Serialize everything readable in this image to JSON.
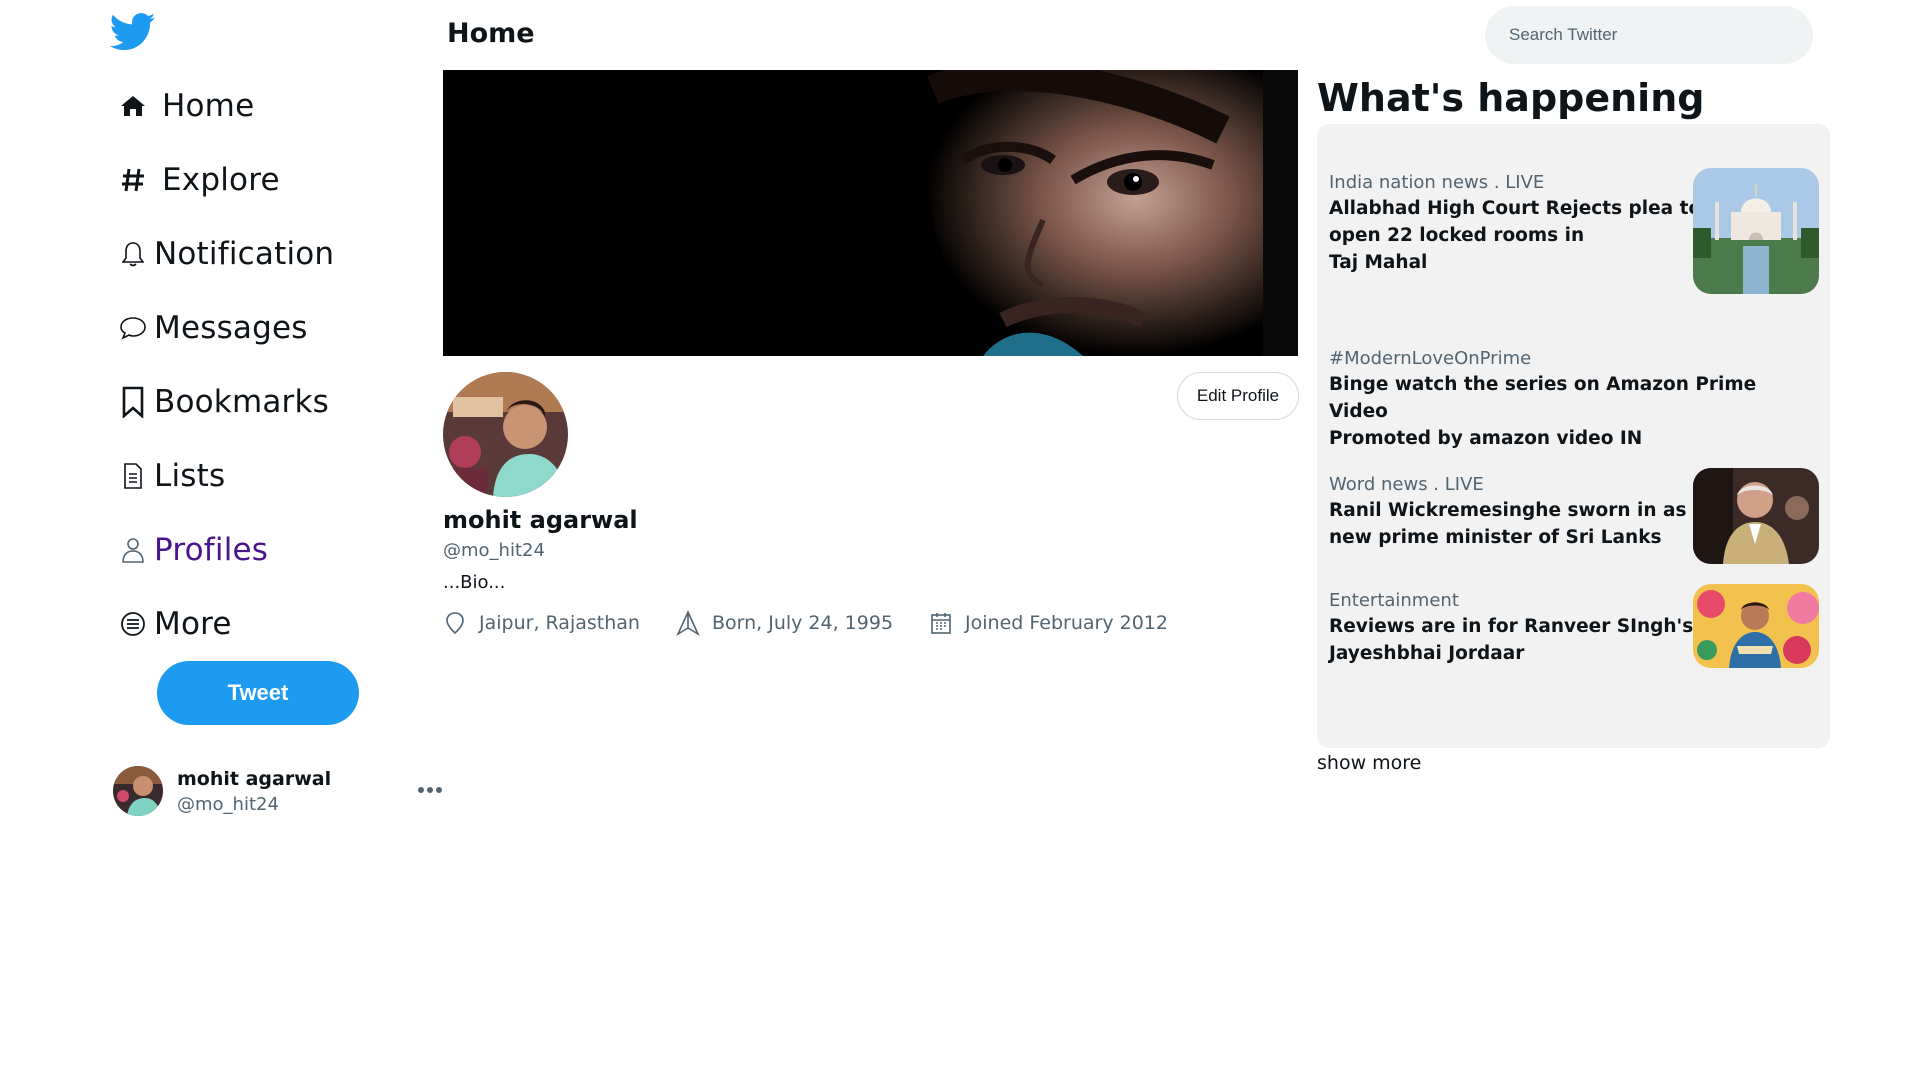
{
  "sidebar": {
    "logo": "twitter-bird-icon",
    "nav": [
      {
        "label": "Home",
        "icon": "home-icon"
      },
      {
        "label": "Explore",
        "icon": "hashtag-icon"
      },
      {
        "label": "Notification",
        "icon": "bell-icon"
      },
      {
        "label": "Messages",
        "icon": "chat-bubble-icon"
      },
      {
        "label": "Bookmarks",
        "icon": "bookmark-icon"
      },
      {
        "label": "Lists",
        "icon": "document-icon"
      },
      {
        "label": "Profiles",
        "icon": "user-icon"
      },
      {
        "label": "More",
        "icon": "more-circle-icon"
      }
    ],
    "active_item": "Profiles",
    "tweet_label": "Tweet",
    "account": {
      "name": "mohit agarwal",
      "handle": "@mo_hit24",
      "more_icon": "ellipsis-icon"
    }
  },
  "main": {
    "title": "Home",
    "edit_profile_label": "Edit Profile",
    "profile": {
      "name": "mohit agarwal",
      "handle": "@mo_hit24",
      "bio": "...Bio...",
      "location": "Jaipur, Rajasthan",
      "born": "Born, July 24, 1995",
      "joined": "Joined February 2012"
    }
  },
  "right": {
    "search_placeholder": "Search Twitter",
    "title": "What's happening",
    "trends": [
      {
        "category": "India nation news . LIVE",
        "headline_lines": [
          "Allabhad High Court Rejects plea to",
          "open 22 locked rooms in",
          "Taj Mahal"
        ],
        "thumb": "taj-mahal-image"
      },
      {
        "category": "#ModernLoveOnPrime",
        "headline_lines": [
          "Binge watch the series on Amazon Prime Video",
          "Promoted by amazon video IN"
        ],
        "thumb": null
      },
      {
        "category": "Word news . LIVE",
        "headline_lines": [
          "Ranil Wickremesinghe sworn in as",
          "new prime minister of Sri Lanks"
        ],
        "thumb": "politician-image"
      },
      {
        "category": "Entertainment",
        "headline_lines": [
          "Reviews are in for Ranveer SIngh's",
          "Jayeshbhai Jordaar"
        ],
        "thumb": "movie-still-image"
      }
    ],
    "show_more_label": "show more"
  },
  "colors": {
    "accent": "#1d9bf0",
    "active_nav": "#4a148c",
    "muted_text": "#536471",
    "panel_bg": "#f2f2f2",
    "search_bg": "#eff3f4"
  }
}
